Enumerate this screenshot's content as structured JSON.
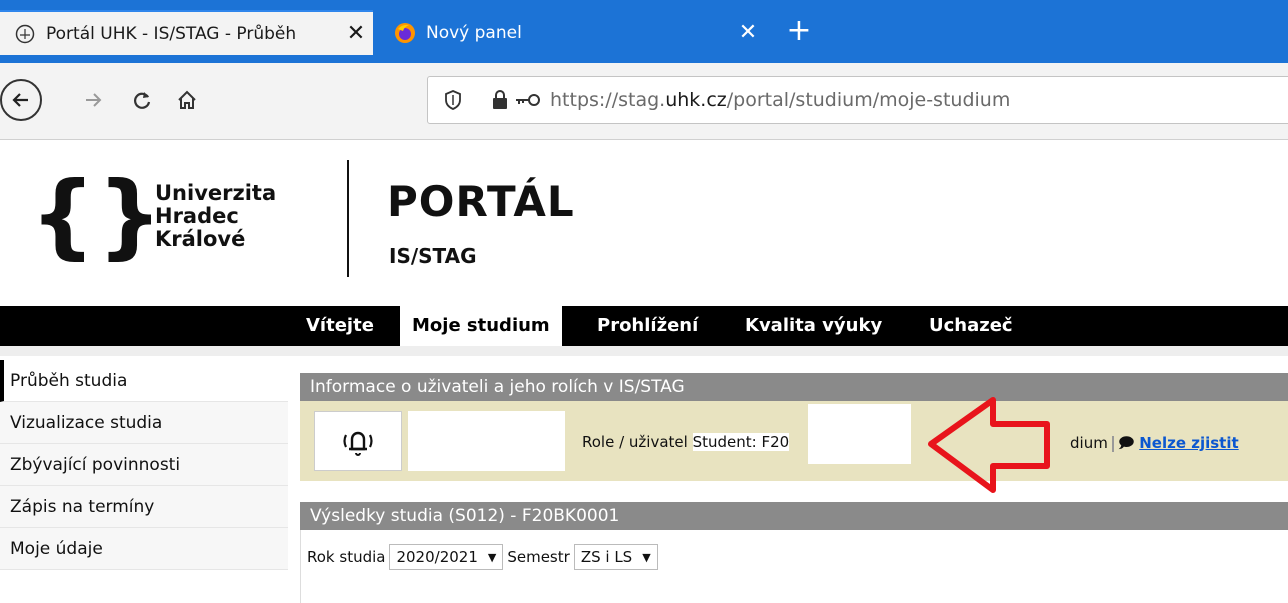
{
  "browser": {
    "tabs": [
      {
        "title": "Portál UHK - IS/STAG - Průběh",
        "close": "✕",
        "icon": "help-circle-icon"
      },
      {
        "title": "Nový panel",
        "close": "✕",
        "icon": "firefox-icon"
      }
    ],
    "new_tab": "+",
    "url_host_pre": "https://stag.",
    "url_host_bold": "uhk.cz",
    "url_path": "/portal/studium/moje-studium"
  },
  "logo": {
    "brace_left": "{",
    "brace_right": "}",
    "university_line1": "Univerzita",
    "university_line2": "Hradec",
    "university_line3": "Králové",
    "portal": "PORTÁL",
    "portal_sub": "IS/STAG"
  },
  "main_menu": [
    "Vítejte",
    "Moje studium",
    "Prohlížení",
    "Kvalita výuky",
    "Uchazeč"
  ],
  "sidebar": [
    "Průběh studia",
    "Vizualizace studia",
    "Zbývající povinnosti",
    "Zápis na termíny",
    "Moje údaje"
  ],
  "user_panel": {
    "title": "Informace o uživateli a jeho rolích v IS/STAG",
    "role_label": "Role / uživatel",
    "role_value": "Student: F20",
    "studium_tail": "dium",
    "unknown_link": "Nelze zjistit"
  },
  "results_panel": {
    "title": "Výsledky studia (S012) - F20BK0001",
    "year_label": "Rok studia",
    "year_value": "2020/2021",
    "semester_label": "Semestr",
    "semester_value": "ZS i LS"
  },
  "colors": {
    "tabstrip": "#1c73d6",
    "panel_head": "#8a8a8a",
    "user_panel_bg": "#e8e3c0",
    "arrow": "#e8141b"
  }
}
